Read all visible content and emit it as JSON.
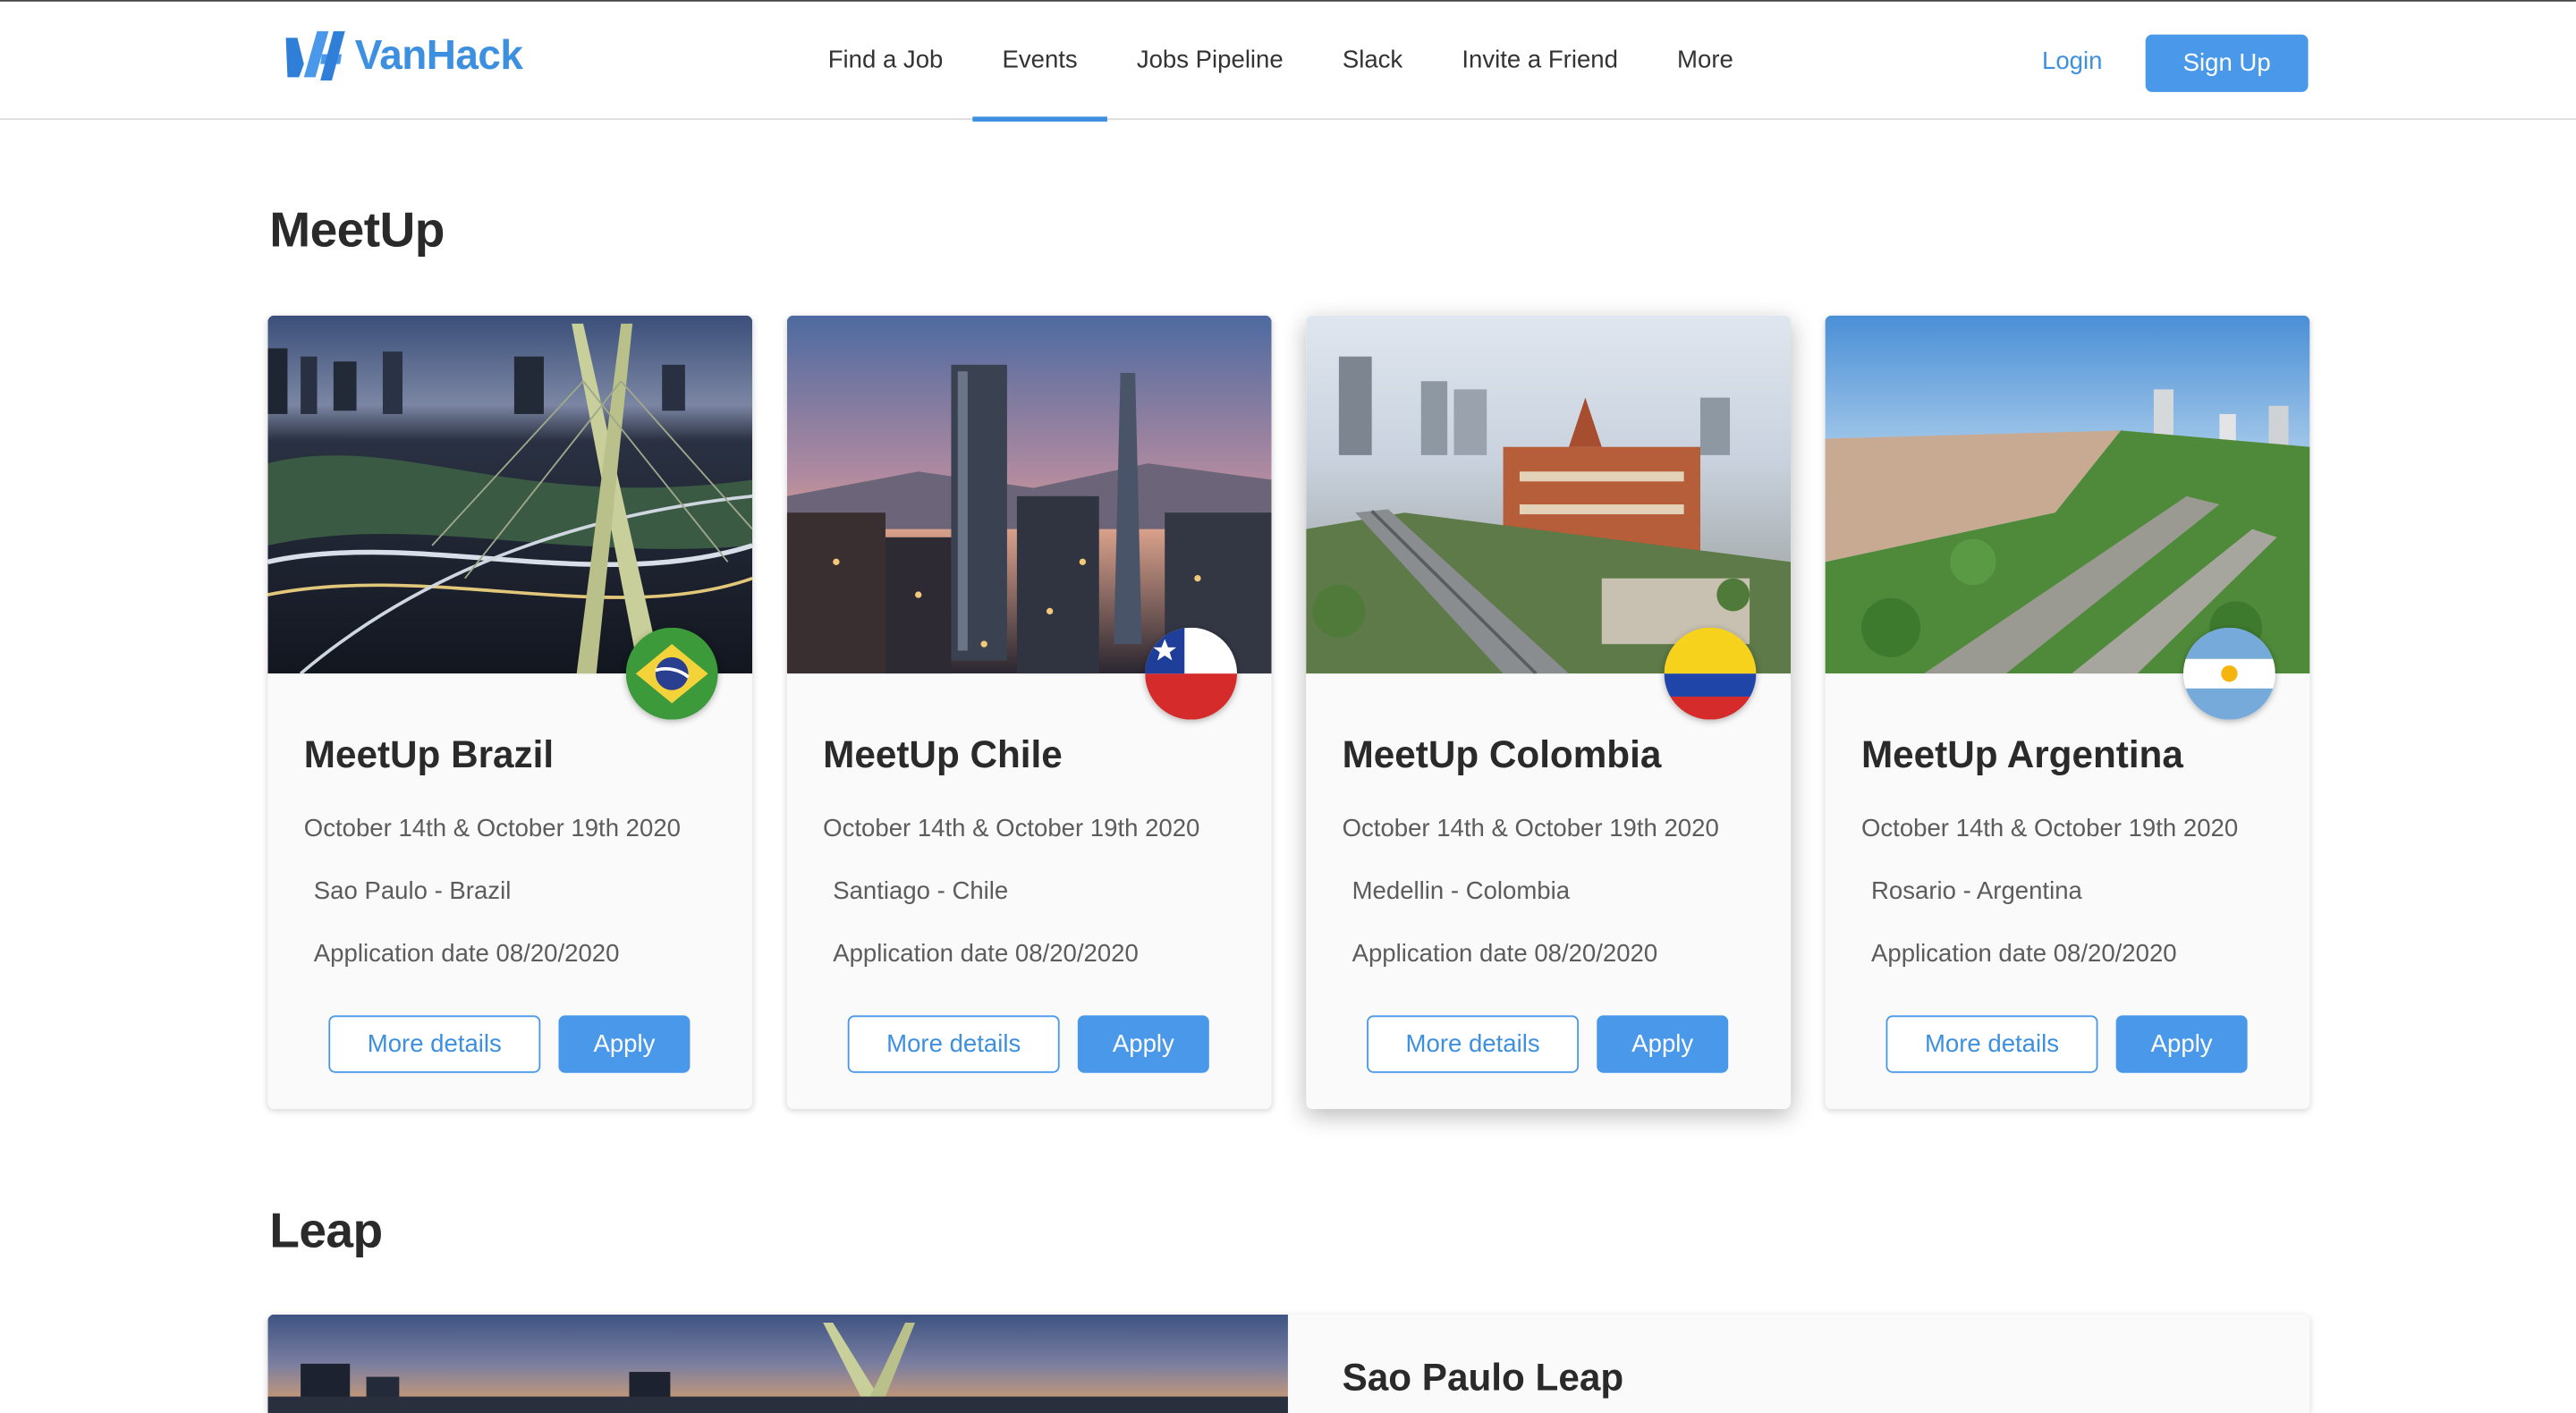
{
  "header": {
    "brand": "VanHack",
    "nav": [
      {
        "label": "Find a Job",
        "active": false
      },
      {
        "label": "Events",
        "active": true
      },
      {
        "label": "Jobs Pipeline",
        "active": false
      },
      {
        "label": "Slack",
        "active": false
      },
      {
        "label": "Invite a Friend",
        "active": false
      },
      {
        "label": "More",
        "active": false
      }
    ],
    "login": "Login",
    "signup": "Sign Up"
  },
  "meetup": {
    "title": "MeetUp",
    "cards": [
      {
        "title": "MeetUp Brazil",
        "date": "October 14th & October 19th 2020",
        "location": "Sao Paulo - Brazil",
        "application": "Application date 08/20/2020",
        "more": "More details",
        "apply": "Apply",
        "flag": "brazil-flag"
      },
      {
        "title": "MeetUp Chile",
        "date": "October 14th & October 19th 2020",
        "location": "Santiago - Chile",
        "application": "Application date 08/20/2020",
        "more": "More details",
        "apply": "Apply",
        "flag": "chile-flag"
      },
      {
        "title": "MeetUp Colombia",
        "date": "October 14th & October 19th 2020",
        "location": "Medellin - Colombia",
        "application": "Application date 08/20/2020",
        "more": "More details",
        "apply": "Apply",
        "flag": "colombia-flag"
      },
      {
        "title": "MeetUp Argentina",
        "date": "October 14th & October 19th 2020",
        "location": "Rosario - Argentina",
        "application": "Application date 08/20/2020",
        "more": "More details",
        "apply": "Apply",
        "flag": "argentina-flag"
      }
    ]
  },
  "leap": {
    "title": "Leap",
    "card_title": "Sao Paulo Leap"
  },
  "colors": {
    "accent": "#4a98ea",
    "brand": "#3d8fe0"
  }
}
